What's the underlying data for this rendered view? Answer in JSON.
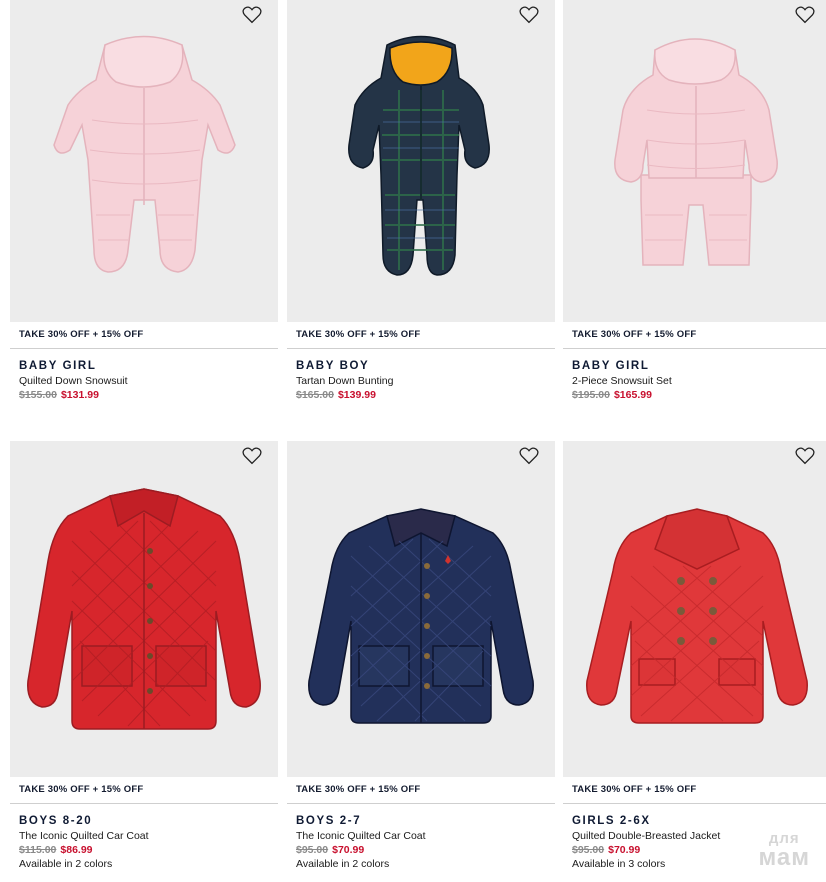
{
  "products": [
    {
      "promo": "TAKE 30% OFF + 15% OFF",
      "category": "BABY GIRL",
      "name": "Quilted Down Snowsuit",
      "old_price": "$155.00",
      "sale_price": "$131.99",
      "colors_text": "",
      "item_color": "#f7d3d8",
      "item_shade": "#e8b7bf",
      "type": "snowsuit-hood"
    },
    {
      "promo": "TAKE 30% OFF + 15% OFF",
      "category": "BABY BOY",
      "name": "Tartan Down Bunting",
      "old_price": "$165.00",
      "sale_price": "$139.99",
      "colors_text": "",
      "item_color": "#243447",
      "item_shade": "#1a4a3a",
      "type": "bunting"
    },
    {
      "promo": "TAKE 30% OFF + 15% OFF",
      "category": "BABY GIRL",
      "name": "2-Piece Snowsuit Set",
      "old_price": "$195.00",
      "sale_price": "$165.99",
      "colors_text": "",
      "item_color": "#f7d3d8",
      "item_shade": "#e8b7bf",
      "type": "two-piece"
    },
    {
      "promo": "TAKE 30% OFF + 15% OFF",
      "category": "BOYS 8-20",
      "name": "The Iconic Quilted Car Coat",
      "old_price": "$115.00",
      "sale_price": "$86.99",
      "colors_text": "Available in 2 colors",
      "item_color": "#d7262c",
      "item_shade": "#a81a22",
      "type": "car-coat"
    },
    {
      "promo": "TAKE 30% OFF + 15% OFF",
      "category": "BOYS 2-7",
      "name": "The Iconic Quilted Car Coat",
      "old_price": "$95.00",
      "sale_price": "$70.99",
      "colors_text": "Available in 2 colors",
      "item_color": "#22305a",
      "item_shade": "#141d3a",
      "type": "car-coat"
    },
    {
      "promo": "TAKE 30% OFF + 15% OFF",
      "category": "GIRLS 2-6X",
      "name": "Quilted Double-Breasted Jacket",
      "old_price": "$95.00",
      "sale_price": "$70.99",
      "colors_text": "Available in 3 colors",
      "item_color": "#e0383a",
      "item_shade": "#b52326",
      "type": "peacoat"
    }
  ],
  "watermark": {
    "line1": "для",
    "line2": "мам"
  }
}
